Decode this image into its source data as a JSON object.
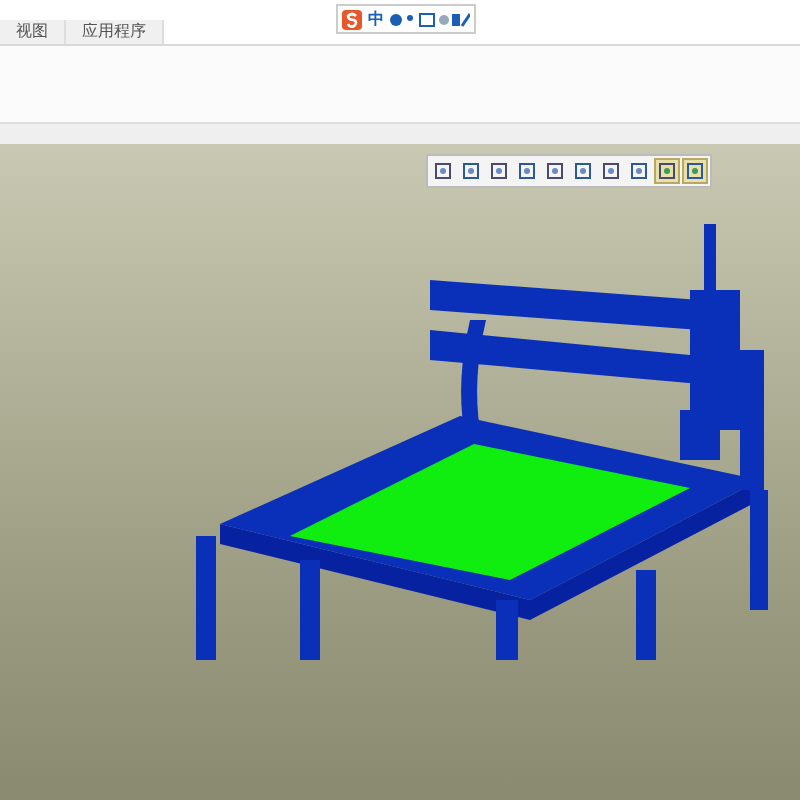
{
  "tabs": [
    {
      "label": "视图",
      "selected": false
    },
    {
      "label": "应用程序",
      "selected": false
    }
  ],
  "ime_bar": {
    "mode": "中"
  },
  "view_toolbar": [
    {
      "selected": false
    },
    {
      "selected": false
    },
    {
      "selected": false
    },
    {
      "selected": false
    },
    {
      "selected": false
    },
    {
      "selected": false
    },
    {
      "selected": false
    },
    {
      "selected": false
    },
    {
      "selected": true
    },
    {
      "selected": true
    }
  ]
}
